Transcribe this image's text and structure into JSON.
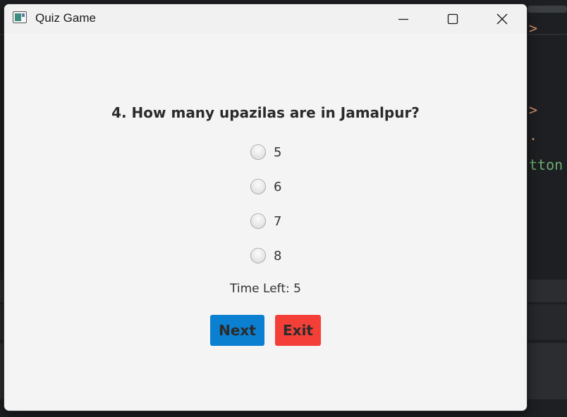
{
  "background_editor": {
    "fragments": [
      {
        "text": ">",
        "kind": "op"
      },
      {
        "text": ">",
        "kind": "op"
      },
      {
        "text": ".",
        "kind": "op"
      },
      {
        "text": "tton",
        "kind": "green"
      }
    ]
  },
  "window": {
    "title": "Quiz Game",
    "icon": "app-window-icon",
    "controls": {
      "minimize": "minimize-icon",
      "maximize": "maximize-icon",
      "close": "close-icon"
    }
  },
  "quiz": {
    "question": "4. How many upazilas are in Jamalpur?",
    "options": [
      "5",
      "6",
      "7",
      "8"
    ],
    "timer_text": "Time Left: 5",
    "buttons": {
      "next": "Next",
      "exit": "Exit"
    }
  },
  "colors": {
    "next_button": "#0b7fd0",
    "exit_button": "#f33f37",
    "window_bg": "#f4f4f4",
    "editor_bg": "#1e1f22"
  }
}
